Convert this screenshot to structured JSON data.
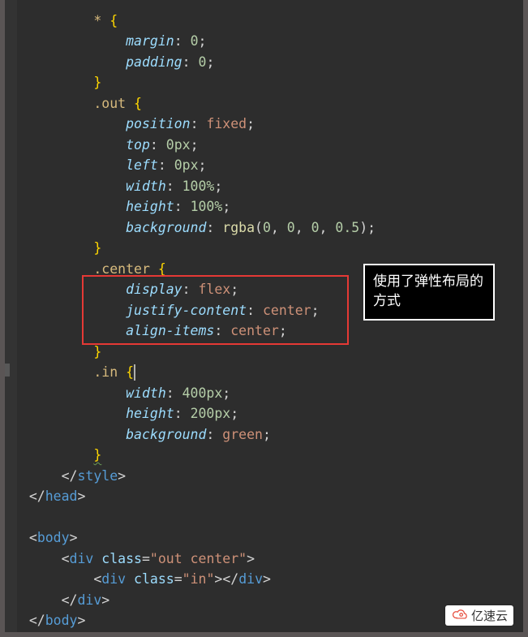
{
  "callout": "使用了弹性布局的方式",
  "watermark": "亿速云",
  "code": {
    "lines": [
      {
        "type": "raw",
        "indent": 4,
        "tokens": [
          [
            "sel",
            "*"
          ],
          [
            "p",
            " "
          ],
          [
            "br",
            "{"
          ]
        ]
      },
      {
        "type": "decl",
        "indent": 6,
        "prop": "margin",
        "vals": [
          [
            "num",
            "0"
          ]
        ]
      },
      {
        "type": "decl",
        "indent": 6,
        "prop": "padding",
        "vals": [
          [
            "num",
            "0"
          ]
        ]
      },
      {
        "type": "raw",
        "indent": 4,
        "tokens": [
          [
            "br",
            "}"
          ]
        ]
      },
      {
        "type": "raw",
        "indent": 4,
        "tokens": [
          [
            "sel",
            ".out"
          ],
          [
            "p",
            " "
          ],
          [
            "br",
            "{"
          ]
        ]
      },
      {
        "type": "decl",
        "indent": 6,
        "prop": "position",
        "vals": [
          [
            "kw",
            "fixed"
          ]
        ]
      },
      {
        "type": "decl",
        "indent": 6,
        "prop": "top",
        "vals": [
          [
            "num",
            "0px"
          ]
        ]
      },
      {
        "type": "decl",
        "indent": 6,
        "prop": "left",
        "vals": [
          [
            "num",
            "0px"
          ]
        ]
      },
      {
        "type": "decl",
        "indent": 6,
        "prop": "width",
        "vals": [
          [
            "num",
            "100%"
          ]
        ]
      },
      {
        "type": "decl",
        "indent": 6,
        "prop": "height",
        "vals": [
          [
            "num",
            "100%"
          ]
        ]
      },
      {
        "type": "decl",
        "indent": 6,
        "prop": "background",
        "vals": [
          [
            "fn",
            "rgba"
          ],
          [
            "p",
            "("
          ],
          [
            "num",
            "0"
          ],
          [
            "p",
            ", "
          ],
          [
            "num",
            "0"
          ],
          [
            "p",
            ", "
          ],
          [
            "num",
            "0"
          ],
          [
            "p",
            ", "
          ],
          [
            "num",
            "0.5"
          ],
          [
            "p",
            ")"
          ]
        ]
      },
      {
        "type": "raw",
        "indent": 4,
        "tokens": [
          [
            "br",
            "}"
          ]
        ]
      },
      {
        "type": "raw",
        "indent": 4,
        "tokens": [
          [
            "sel",
            ".center"
          ],
          [
            "p",
            " "
          ],
          [
            "br",
            "{"
          ]
        ]
      },
      {
        "type": "decl",
        "indent": 6,
        "prop": "display",
        "vals": [
          [
            "kw",
            "flex"
          ]
        ]
      },
      {
        "type": "decl",
        "indent": 6,
        "prop": "justify-content",
        "vals": [
          [
            "kw",
            "center"
          ]
        ]
      },
      {
        "type": "decl",
        "indent": 6,
        "prop": "align-items",
        "vals": [
          [
            "kw",
            "center"
          ]
        ]
      },
      {
        "type": "raw",
        "indent": 4,
        "tokens": [
          [
            "br",
            "}"
          ]
        ]
      },
      {
        "type": "raw",
        "indent": 4,
        "tokens": [
          [
            "sel",
            ".in"
          ],
          [
            "p",
            " "
          ],
          [
            "br",
            "{"
          ],
          [
            "cursor",
            ""
          ]
        ]
      },
      {
        "type": "decl",
        "indent": 6,
        "prop": "width",
        "vals": [
          [
            "num",
            "400px"
          ]
        ]
      },
      {
        "type": "decl",
        "indent": 6,
        "prop": "height",
        "vals": [
          [
            "num",
            "200px"
          ]
        ]
      },
      {
        "type": "decl",
        "indent": 6,
        "prop": "background",
        "vals": [
          [
            "kw",
            "green"
          ]
        ]
      },
      {
        "type": "raw",
        "indent": 4,
        "tokens": [
          [
            "br wave",
            "}"
          ]
        ]
      },
      {
        "type": "raw",
        "indent": 2,
        "tokens": [
          [
            "p",
            "</"
          ],
          [
            "tag",
            "style"
          ],
          [
            "p",
            ">"
          ]
        ]
      },
      {
        "type": "raw",
        "indent": 0,
        "tokens": [
          [
            "p",
            "</"
          ],
          [
            "tag",
            "head"
          ],
          [
            "p",
            ">"
          ]
        ]
      },
      {
        "type": "blank"
      },
      {
        "type": "raw",
        "indent": 0,
        "tokens": [
          [
            "p",
            "<"
          ],
          [
            "tag",
            "body"
          ],
          [
            "p",
            ">"
          ]
        ]
      },
      {
        "type": "raw",
        "indent": 2,
        "tokens": [
          [
            "p",
            "<"
          ],
          [
            "tag",
            "div"
          ],
          [
            "p",
            " "
          ],
          [
            "attr",
            "class"
          ],
          [
            "p",
            "="
          ],
          [
            "str",
            "\"out center\""
          ],
          [
            "p",
            ">"
          ]
        ]
      },
      {
        "type": "raw",
        "indent": 4,
        "tokens": [
          [
            "p",
            "<"
          ],
          [
            "tag",
            "div"
          ],
          [
            "p",
            " "
          ],
          [
            "attr",
            "class"
          ],
          [
            "p",
            "="
          ],
          [
            "str",
            "\"in\""
          ],
          [
            "p",
            "></"
          ],
          [
            "tag",
            "div"
          ],
          [
            "p",
            ">"
          ]
        ]
      },
      {
        "type": "raw",
        "indent": 2,
        "tokens": [
          [
            "p",
            "</"
          ],
          [
            "tag",
            "div"
          ],
          [
            "p",
            ">"
          ]
        ]
      },
      {
        "type": "raw",
        "indent": 0,
        "tokens": [
          [
            "p",
            "</"
          ],
          [
            "tag",
            "body"
          ],
          [
            "p",
            ">"
          ]
        ]
      }
    ]
  }
}
